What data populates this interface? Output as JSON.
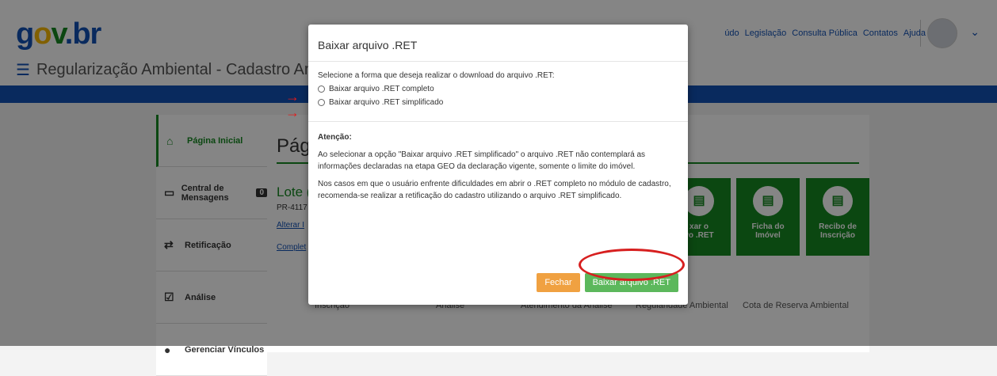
{
  "header": {
    "system_title": "Regularização Ambiental - Cadastro Ambiental Rural",
    "links": [
      "údo",
      "Legislação",
      "Consulta Pública",
      "Contatos",
      "Ajuda"
    ]
  },
  "sidebar": {
    "items": [
      {
        "label": "Página Inicial",
        "icon": "home-icon"
      },
      {
        "label": "Central de Mensagens",
        "icon": "inbox-icon",
        "badge": "0"
      },
      {
        "label": "Retificação",
        "icon": "swap-icon"
      },
      {
        "label": "Análise",
        "icon": "check-square-icon"
      },
      {
        "label": "Gerenciar Vínculos",
        "icon": "user-icon"
      }
    ]
  },
  "main": {
    "page_title": "Pág",
    "lote_title": "Lote (",
    "pr_code": "PR-4117",
    "alterar_link": "Alterar I",
    "completar_link": "Complet",
    "tiles": [
      {
        "label": "xar o\nvo .RET"
      },
      {
        "label": "Ficha do\nImóvel"
      },
      {
        "label": "Recibo de\nInscrição"
      }
    ],
    "steps": [
      "Inscrição",
      "Análise",
      "Atendimento da Análise",
      "Regularidade Ambiental",
      "Cota de Reserva Ambiental"
    ]
  },
  "modal": {
    "title": "Baixar arquivo .RET",
    "instruction": "Selecione a forma que deseja realizar o download do arquivo .RET:",
    "options": [
      "Baixar arquivo .RET completo",
      "Baixar arquivo .RET simplificado"
    ],
    "attention_title": "Atenção:",
    "paragraph1": "Ao selecionar a opção \"Baixar arquivo .RET simplificado\" o arquivo .RET não contemplará as informações declaradas na etapa GEO da declaração vigente, somente o limite do imóvel.",
    "paragraph2": "Nos casos em que o usuário enfrente dificuldades em abrir o .RET completo no módulo de cadastro, recomenda-se realizar a retificação do cadastro utilizando o arquivo .RET simplificado.",
    "close_button": "Fechar",
    "download_button": "Baixar arquivo .RET"
  },
  "colors": {
    "primary": "#1351b4",
    "green": "#168821",
    "orange": "#f0a141",
    "download_green": "#5cb85c",
    "annotation_red": "#d71f1f"
  }
}
